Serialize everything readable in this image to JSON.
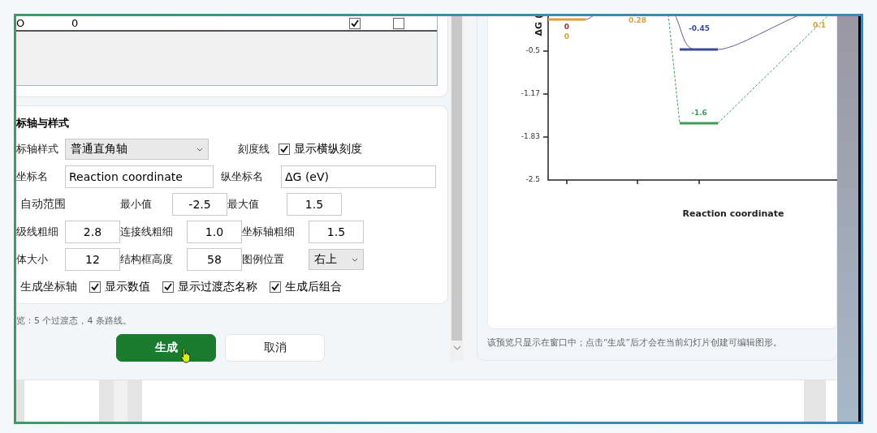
{
  "table_row": {
    "cells": [
      "O",
      "0"
    ],
    "checks": [
      {
        "checked": true
      },
      {
        "checked": false
      }
    ]
  },
  "axis_style": {
    "title": "标轴与样式",
    "rows": [
      [
        {
          "kind": "select",
          "label": "标轴样式",
          "value": "普通直角轴"
        },
        {
          "kind": "check",
          "label": "刻度线",
          "text": "显示横纵刻度",
          "checked": true
        }
      ],
      [
        {
          "kind": "input",
          "label": "坐标名",
          "value": "Reaction coordinate"
        },
        {
          "kind": "input",
          "label": "纵坐标名",
          "value": "ΔG (eV)"
        }
      ],
      [
        {
          "kind": "text",
          "label": "自动范围"
        },
        {
          "kind": "input",
          "label": "最小值",
          "value": "-2.5"
        },
        {
          "kind": "input",
          "label": "最大值",
          "value": "1.5"
        }
      ],
      [
        {
          "kind": "input",
          "label": "级线粗细",
          "value": "2.8"
        },
        {
          "kind": "input",
          "label": "连接线粗细",
          "value": "1.0"
        },
        {
          "kind": "input",
          "label": "坐标轴粗细",
          "value": "1.5"
        }
      ],
      [
        {
          "kind": "input",
          "label": "体大小",
          "value": "12"
        },
        {
          "kind": "input",
          "label": "结构框高度",
          "value": "58"
        },
        {
          "kind": "select",
          "label": "图例位置",
          "value": "右上"
        }
      ],
      [
        {
          "kind": "text",
          "label": "生成坐标轴"
        },
        {
          "kind": "check",
          "text": "显示数值",
          "checked": true
        },
        {
          "kind": "check",
          "text": "显示过渡态名称",
          "checked": true
        },
        {
          "kind": "check",
          "text": "生成后组合",
          "checked": true
        }
      ]
    ]
  },
  "summary": "览：5 个过渡态，4 条路线。",
  "buttons": [
    {
      "label": "生成",
      "kind": "primary"
    },
    {
      "label": "取消",
      "kind": "secondary"
    }
  ],
  "preview": {
    "y_axis_title": "ΔG (",
    "y_tick_labels": [
      "-0.5",
      "-1.17",
      "-1.83",
      "-2.5"
    ],
    "x_axis_title": "Reaction coordinate",
    "value_labels": [
      {
        "text": "0",
        "color": "#9a3b3b"
      },
      {
        "text": "0",
        "color": "#d9a040"
      },
      {
        "text": "0.28",
        "color": "#d9a040"
      },
      {
        "text": "-0.45",
        "color": "#3b4a9a"
      },
      {
        "text": "-1.6",
        "color": "#3f9a5a"
      },
      {
        "text": "0.1",
        "color": "#d9a040"
      }
    ],
    "caption": "该预览只显示在窗口中；点击“生成”后才会在当前幻灯片创建可编辑图形。"
  }
}
